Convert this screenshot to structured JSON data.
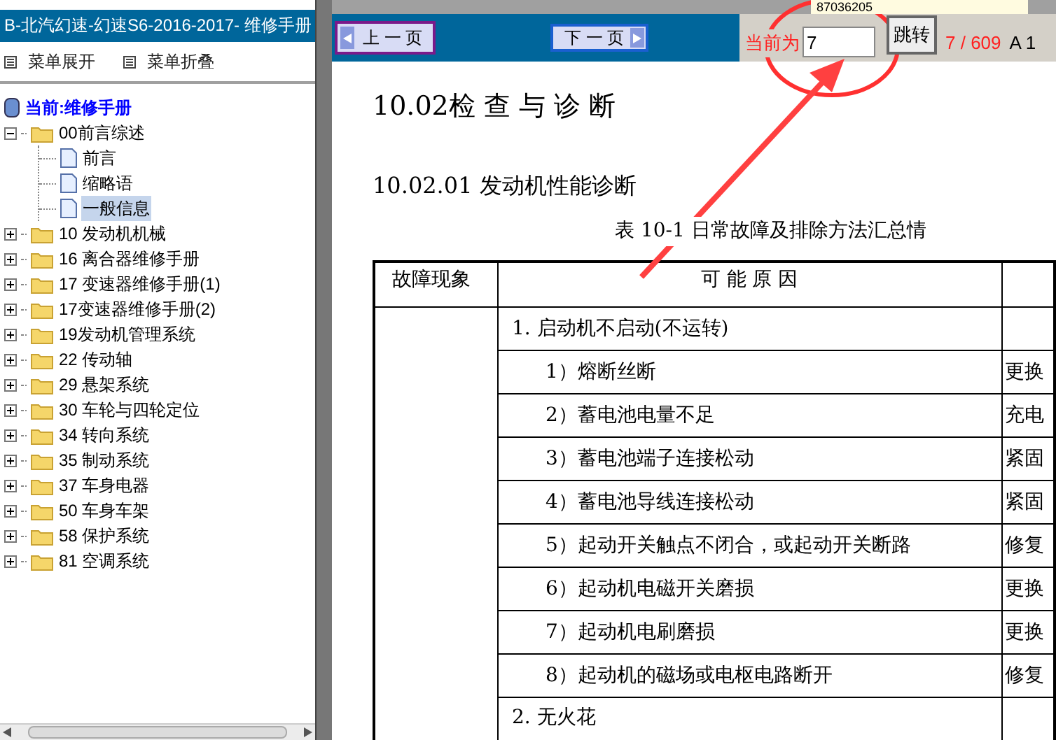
{
  "top_strip": {
    "number": "87036205"
  },
  "sidebar": {
    "title": "B-北汽幻速-幻速S6-2016-2017- 维修手册",
    "menu": [
      {
        "label": "菜单展开"
      },
      {
        "label": "菜单折叠"
      }
    ],
    "tree": {
      "label": "当前:维修手册",
      "children": [
        {
          "label": "00前言综述",
          "kind": "folder",
          "expanded": true,
          "selected": false,
          "children": [
            {
              "label": "前言",
              "kind": "page",
              "selected": false
            },
            {
              "label": "缩略语",
              "kind": "page",
              "selected": false
            },
            {
              "label": "一般信息",
              "kind": "page",
              "selected": true
            }
          ]
        },
        {
          "label": "10 发动机机械",
          "kind": "folder",
          "expanded": false,
          "selected": false
        },
        {
          "label": "16 离合器维修手册",
          "kind": "folder",
          "expanded": false,
          "selected": false
        },
        {
          "label": "17 变速器维修手册(1)",
          "kind": "folder",
          "expanded": false,
          "selected": false
        },
        {
          "label": "17变速器维修手册(2)",
          "kind": "folder",
          "expanded": false,
          "selected": false
        },
        {
          "label": "19发动机管理系统",
          "kind": "folder",
          "expanded": false,
          "selected": false
        },
        {
          "label": "22 传动轴",
          "kind": "folder",
          "expanded": false,
          "selected": false
        },
        {
          "label": "29 悬架系统",
          "kind": "folder",
          "expanded": false,
          "selected": false
        },
        {
          "label": "30 车轮与四轮定位",
          "kind": "folder",
          "expanded": false,
          "selected": false
        },
        {
          "label": "34 转向系统",
          "kind": "folder",
          "expanded": false,
          "selected": false
        },
        {
          "label": "35 制动系统",
          "kind": "folder",
          "expanded": false,
          "selected": false
        },
        {
          "label": "37 车身电器",
          "kind": "folder",
          "expanded": false,
          "selected": false
        },
        {
          "label": "50 车身车架",
          "kind": "folder",
          "expanded": false,
          "selected": false
        },
        {
          "label": "58 保护系统",
          "kind": "folder",
          "expanded": false,
          "selected": false
        },
        {
          "label": "81 空调系统",
          "kind": "folder",
          "expanded": false,
          "selected": false
        }
      ]
    }
  },
  "toolbar": {
    "prev_button": "上 一 页",
    "next_button": "下 一 页",
    "current_label": "当前为",
    "page_input": "7",
    "go_button": "跳转",
    "page_count": "7 / 609",
    "zoom": "A 1"
  },
  "document": {
    "heading": "10.02检 查 与 诊 断",
    "subheading": "10.02.01  发动机性能诊断",
    "caption": "表 10-1 日常故障及排除方法汇总情",
    "table": {
      "columns": [
        "故障现象",
        "可 能 原 因",
        ""
      ],
      "rows": [
        {
          "kind": "group",
          "cause": "1.  启动机不启动(不运转)",
          "remedy": ""
        },
        {
          "kind": "item",
          "cause": "1）熔断丝断",
          "remedy": "更换"
        },
        {
          "kind": "item",
          "cause": "2）蓄电池电量不足",
          "remedy": "充电"
        },
        {
          "kind": "item",
          "cause": "3）蓄电池端子连接松动",
          "remedy": "紧固"
        },
        {
          "kind": "item",
          "cause": "4）蓄电池导线连接松动",
          "remedy": "紧固"
        },
        {
          "kind": "item",
          "cause": "5）起动开关触点不闭合，或起动开关断路",
          "remedy": "修复"
        },
        {
          "kind": "item",
          "cause": "6）起动机电磁开关磨损",
          "remedy": "更换"
        },
        {
          "kind": "item",
          "cause": "7）起动机电刷磨损",
          "remedy": "更换"
        },
        {
          "kind": "item",
          "cause": "8）起动机的磁场或电枢电路断开",
          "remedy": "修复"
        },
        {
          "kind": "group",
          "cause": "2.  无火花",
          "remedy": ""
        }
      ]
    }
  }
}
